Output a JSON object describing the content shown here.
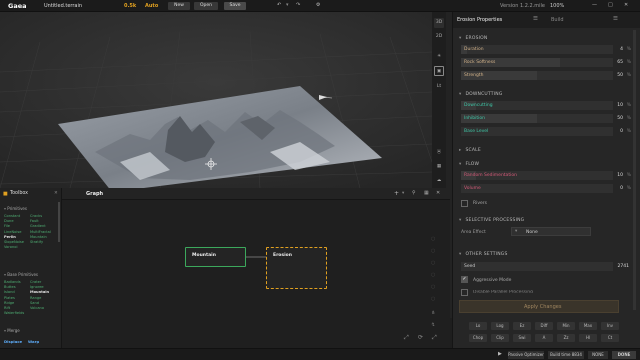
{
  "topbar": {
    "app_name": "Gaea",
    "file_name": "Untitled.terrain",
    "resolution": "0.5k",
    "mode": "Auto",
    "new_label": "New",
    "open_label": "Open",
    "save_label": "Save",
    "version": "Version 1.2.2.mile",
    "zoom": "100%"
  },
  "viewport_tools": [
    "3D",
    "2D",
    "Lt"
  ],
  "properties": {
    "title": "Erosion Properties",
    "build_label": "Build",
    "sections": {
      "erosion": "EROSION",
      "downcutting": "DOWNCUTTING",
      "scale": "SCALE",
      "flow": "FLOW",
      "selective": "SELECTIVE PROCESSING",
      "other": "OTHER SETTINGS"
    },
    "erosion_params": [
      {
        "label": "Duration",
        "value": "4",
        "unit": "%",
        "fill": 0.04,
        "color": "#d3b38a"
      },
      {
        "label": "Rock Softness",
        "value": "65",
        "unit": "%",
        "fill": 0.65,
        "color": "#d3b38a"
      },
      {
        "label": "Strength",
        "value": "50",
        "unit": "%",
        "fill": 0.5,
        "color": "#d3b38a"
      }
    ],
    "downcut_params": [
      {
        "label": "Downcutting",
        "value": "10",
        "unit": "%",
        "fill": 0.1,
        "color": "#3fc8a8"
      },
      {
        "label": "Inhibition",
        "value": "50",
        "unit": "%",
        "fill": 0.5,
        "color": "#3fc8a8"
      },
      {
        "label": "Base Level",
        "value": "0",
        "unit": "%",
        "fill": 0,
        "color": "#3fc8a8"
      }
    ],
    "flow_params": [
      {
        "label": "Random Sedimentation",
        "value": "10",
        "unit": "%",
        "fill": 0.1,
        "color": "#d45a78"
      },
      {
        "label": "Volume",
        "value": "0",
        "unit": "%",
        "fill": 0,
        "color": "#d45a78"
      }
    ],
    "rivers_label": "Rivers",
    "area_effect_label": "Area Effect",
    "area_effect_value": "None",
    "seed_label": "Seed",
    "seed_value": "2741",
    "aggressive_label": "Aggressive Mode",
    "parallel_label": "Disable Parallel Processing",
    "apply_label": "Apply Changes"
  },
  "key_buttons_row1": [
    "Lo",
    "Log",
    "Ez",
    "Diff",
    "Min",
    "Max",
    "Inv"
  ],
  "key_buttons_row2": [
    "Chop",
    "Clip",
    "Swi",
    "A",
    "Zz",
    "Hl",
    "Ct"
  ],
  "toolbox": {
    "title": "Toolbox",
    "primitives_title": "Primitives",
    "primitives": [
      "Constant",
      "Cracks",
      "Dune",
      "Fault",
      "File",
      "Gradient",
      "LineNoise",
      "MultiFractal",
      "Perlin",
      "Mountain",
      "SlopeNoise",
      "Stratify",
      "Voronoi"
    ],
    "primitives_bold": "Perlin",
    "sec2_title": "Base Primitives",
    "primitives2": [
      "Badlands",
      "Crater",
      "Buttes",
      "Ignoree",
      "Island",
      "Mountain",
      "Plates",
      "Range",
      "Ridge",
      "Sand",
      "Rift",
      "Volcano",
      "Waterfields"
    ],
    "primitives2_bold": "Mountain",
    "sec3_title": "Merge",
    "bottom_items": [
      "Displace",
      "Warp"
    ]
  },
  "graph": {
    "tab_label": "Graph",
    "nodes": [
      {
        "label": "Mountain",
        "accent": "#3ca85c"
      },
      {
        "label": "Erosion",
        "accent": "#e0a020"
      }
    ]
  },
  "statusbar": {
    "passive": "Passive Optimizer",
    "build_time": "Build time 8834",
    "none_label": "NONE",
    "done_label": "DONE"
  }
}
